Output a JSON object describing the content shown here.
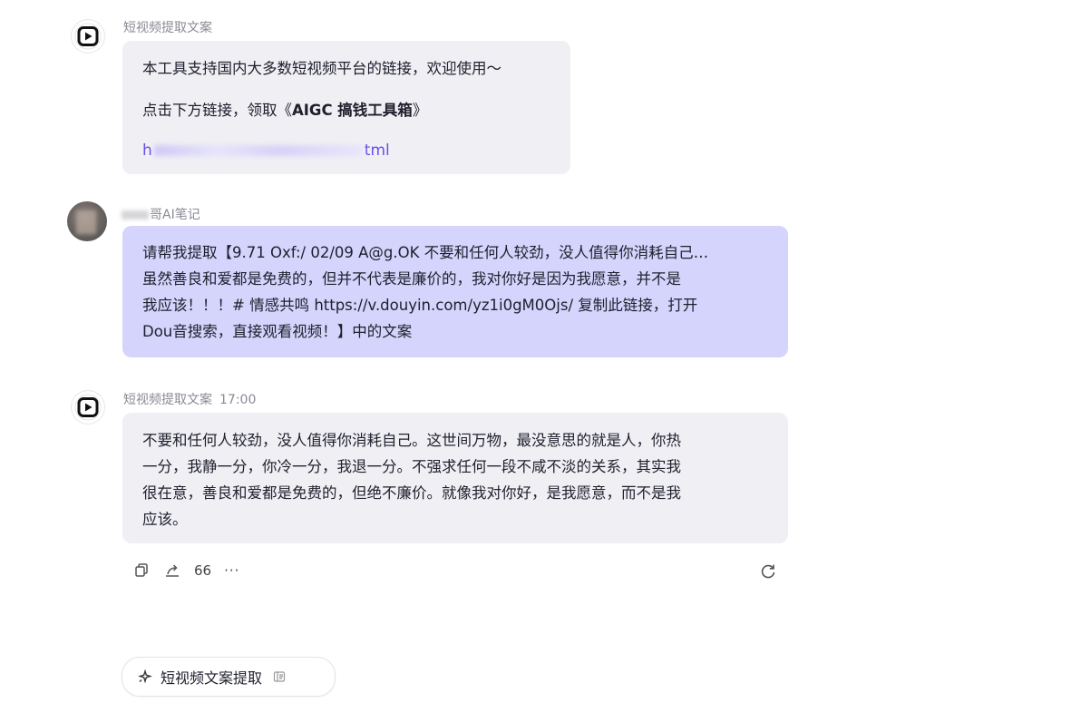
{
  "messages": [
    {
      "sender": "短视频提取文案",
      "lines": [
        "本工具支持国内大多数短视频平台的链接，欢迎使用～"
      ],
      "cta_prefix": "点击下方链接，领取《",
      "cta_bold": "AIGC 搞钱工具箱",
      "cta_suffix": "》",
      "link_start": "h",
      "link_end": "tml"
    },
    {
      "sender_suffix": "哥AI笔记",
      "lines": [
        "请帮我提取【9.71 Oxf:/ 02/09 A@g.OK 不要和任何人较劲，没人值得你消耗自己…",
        "虽然善良和爱都是免费的，但并不代表是廉价的，我对你好是因为我愿意，并不是",
        "我应该！！！# 情感共鸣  https://v.douyin.com/yz1i0gM0Ojs/ 复制此链接，打开",
        "Dou音搜索，直接观看视频！】中的文案"
      ]
    },
    {
      "sender": "短视频提取文案",
      "time": "17:00",
      "lines": [
        "不要和任何人较劲，没人值得你消耗自己。这世间万物，最没意思的就是人，你热",
        "一分，我静一分，你冷一分，我退一分。不强求任何一段不咸不淡的关系，其实我",
        "很在意，善良和爱都是免费的，但绝不廉价。就像我对你好，是我愿意，而不是我",
        "应该。"
      ]
    }
  ],
  "actions": {
    "quote_label": "66",
    "more_label": "···"
  },
  "chip": {
    "label": "短视频文案提取"
  }
}
